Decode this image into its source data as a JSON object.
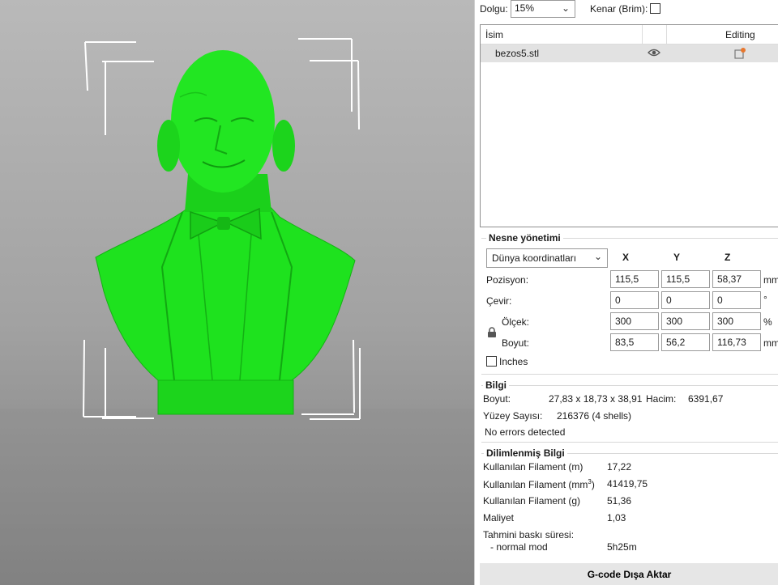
{
  "top_bar": {
    "infill_label": "Dolgu:",
    "infill_value": "15%",
    "brim_label": "Kenar (Brim):",
    "brim_checked": false
  },
  "object_list": {
    "col_name": "İsim",
    "col_editing": "Editing",
    "items": [
      {
        "name": "bezos5.stl",
        "visibility_icon": "eye-icon",
        "edit_icon": "edit-settings-icon"
      }
    ]
  },
  "object_manipulation": {
    "title": "Nesne yönetimi",
    "coord_system": "Dünya koordinatları",
    "axis_x": "X",
    "axis_y": "Y",
    "axis_z": "Z",
    "position_label": "Pozisyon:",
    "position": [
      "115,5",
      "115,5",
      "58,37"
    ],
    "position_unit": "mm",
    "rotate_label": "Çevir:",
    "rotation": [
      "0",
      "0",
      "0"
    ],
    "rotation_unit": "°",
    "scale_label": "Ölçek:",
    "scale": [
      "300",
      "300",
      "300"
    ],
    "scale_unit": "%",
    "size_label": "Boyut:",
    "size": [
      "83,5",
      "56,2",
      "116,73"
    ],
    "size_unit": "mm",
    "inches_label": "Inches",
    "inches_checked": false,
    "lock_icon": "lock-icon"
  },
  "info": {
    "title": "Bilgi",
    "size_label": "Boyut:",
    "size_value": "27,83 x 18,73 x 38,91",
    "volume_label": "Hacim:",
    "volume_value": "6391,67",
    "facets_label": "Yüzey Sayısı:",
    "facets_value": "216376 (4 shells)",
    "errors": "No errors detected"
  },
  "sliced_info": {
    "title": "Dilimlenmiş Bilgi",
    "filament_m_label": "Kullanılan Filament (m)",
    "filament_m_value": "17,22",
    "filament_mm3_label": "Kullanılan Filament (mm",
    "filament_mm3_sup": "3",
    "filament_mm3_close": ")",
    "filament_mm3_value": "41419,75",
    "filament_g_label": "Kullanılan Filament (g)",
    "filament_g_value": "51,36",
    "cost_label": "Maliyet",
    "cost_value": "1,03",
    "est_time_label": "Tahmini baskı süresi:",
    "normal_mode_label": "- normal mod",
    "normal_mode_value": "5h25m"
  },
  "export_button": "G-code Dışa Aktar",
  "colors": {
    "model_green": "#1ee21e",
    "viewport_top": "#b9b9b9",
    "viewport_bottom": "#7e7e7e",
    "selection_row": "#e2e2e2",
    "edit_icon_accent": "#e8772e"
  }
}
